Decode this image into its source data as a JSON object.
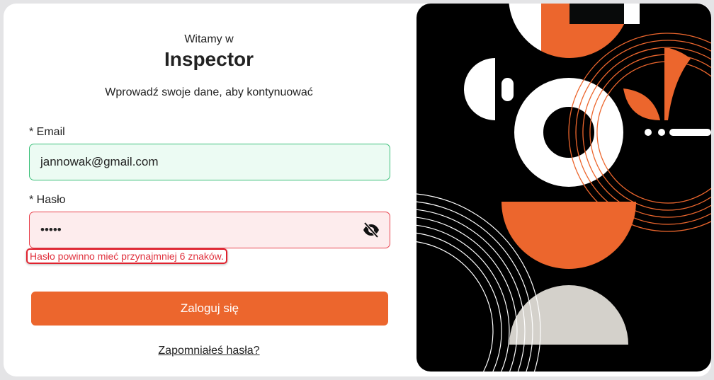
{
  "header": {
    "welcome": "Witamy w",
    "app_name": "Inspector",
    "subtitle": "Wprowadź swoje dane, aby kontynuować"
  },
  "form": {
    "email_label": "* Email",
    "email_value": "jannowak@gmail.com",
    "password_label": "* Hasło",
    "password_value": "•••••",
    "password_icon": "eye-slash-icon",
    "password_error": "Hasło powinno mieć przynajmniej 6 znaków.",
    "submit_label": "Zaloguj się",
    "forgot_label": "Zapomniałeś hasła?"
  },
  "colors": {
    "accent": "#ec662d",
    "success_border": "#3cc07a",
    "error": "#e0323e"
  }
}
